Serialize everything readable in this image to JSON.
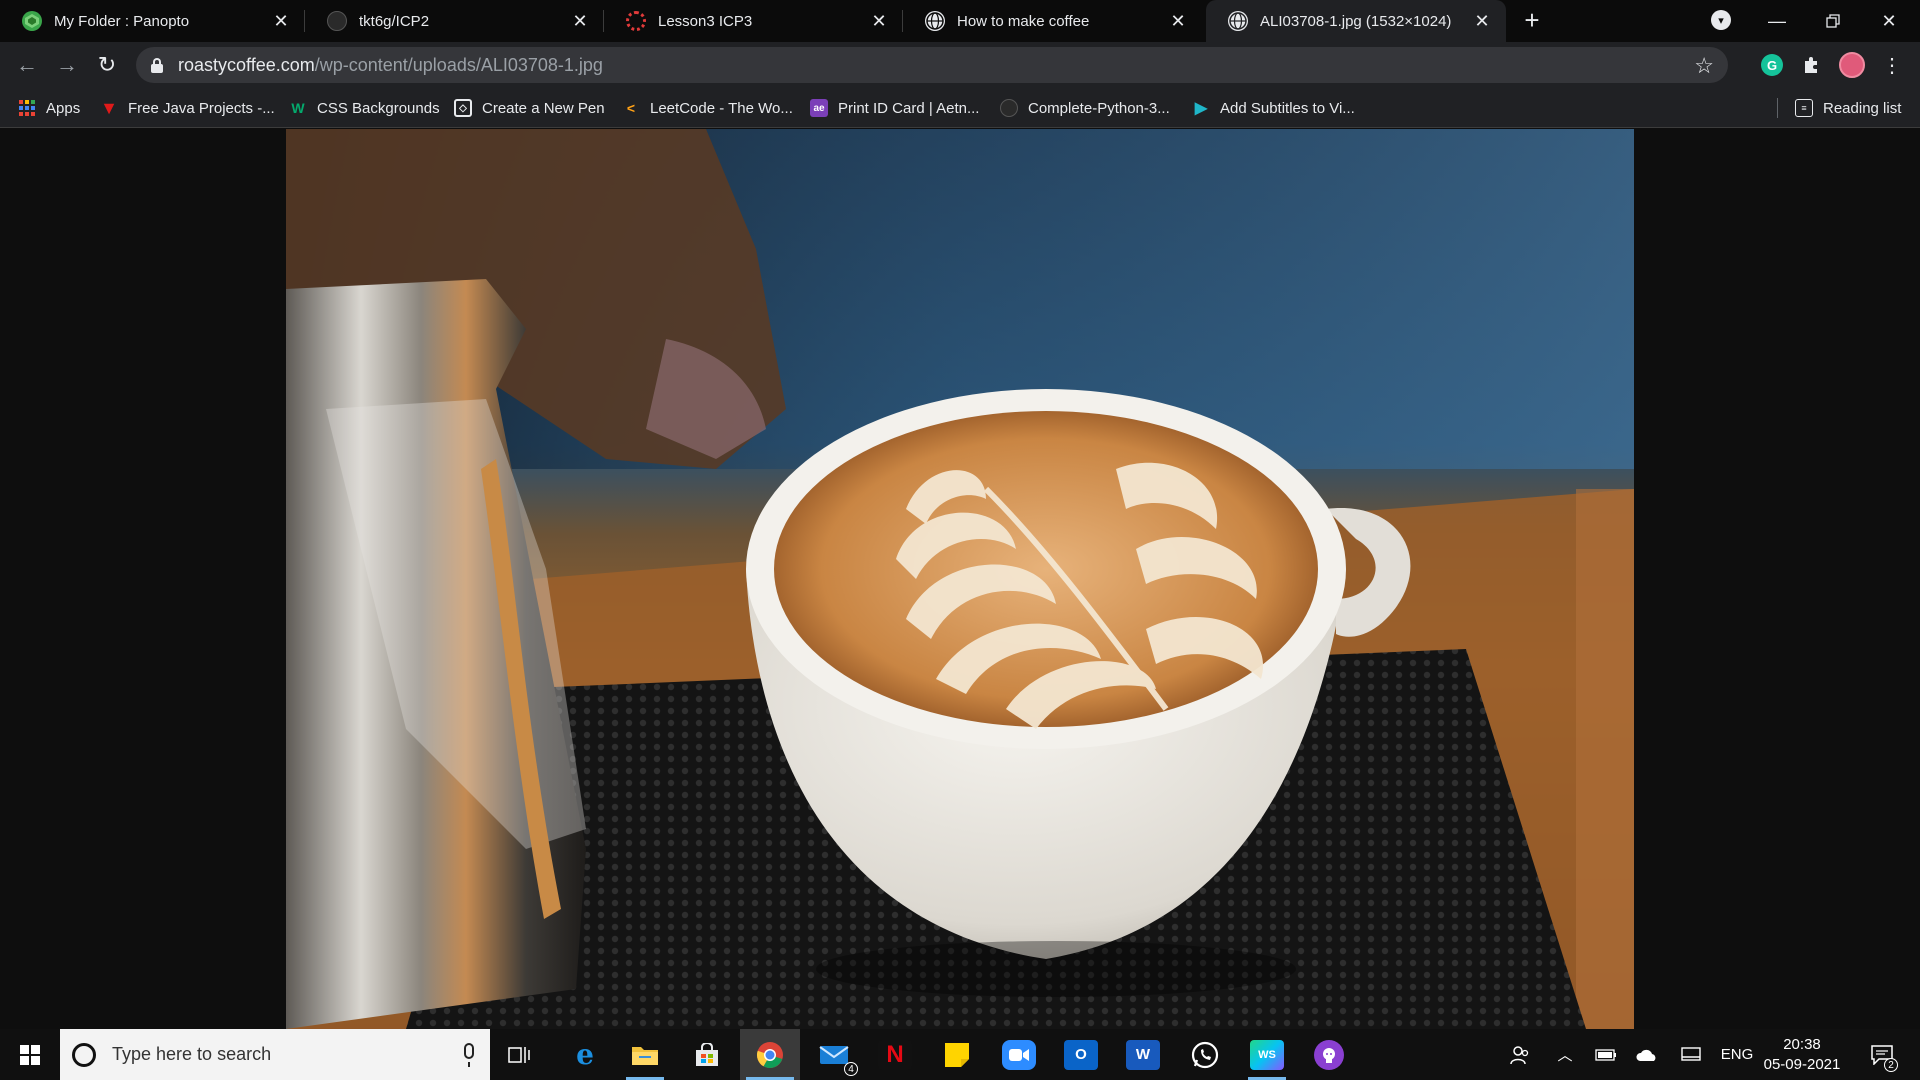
{
  "browser": {
    "tabs": [
      {
        "title": "My Folder : Panopto",
        "icon": "panopto-icon",
        "color": "#3aa64a",
        "active": false
      },
      {
        "title": "tkt6g/ICP2",
        "icon": "github-icon",
        "color": "#3c3c3c",
        "active": false
      },
      {
        "title": "Lesson3 ICP3",
        "icon": "ring-icon",
        "color": "#d03030",
        "active": false
      },
      {
        "title": "How to make coffee",
        "icon": "globe-icon",
        "color": "#e8eaed",
        "active": false
      },
      {
        "title": "ALI03708-1.jpg (1532×1024)",
        "icon": "globe-icon",
        "color": "#e8eaed",
        "active": true
      }
    ],
    "address": {
      "host": "roastycoffee.com",
      "path": "/wp-content/uploads/ALI03708-1.jpg"
    },
    "bookmarks": [
      {
        "label": "Apps",
        "icon": "apps-grid-icon"
      },
      {
        "label": "Free Java Projects -...",
        "icon": "red-v-icon"
      },
      {
        "label": "CSS Backgrounds",
        "icon": "w3-icon"
      },
      {
        "label": "Create a New Pen",
        "icon": "codepen-icon"
      },
      {
        "label": "LeetCode - The Wo...",
        "icon": "leetcode-icon"
      },
      {
        "label": "Print ID Card | Aetn...",
        "icon": "aetn-icon"
      },
      {
        "label": "Complete-Python-3...",
        "icon": "github-icon"
      },
      {
        "label": "Add Subtitles to Vi...",
        "icon": "play-icon"
      }
    ],
    "reading_list": "Reading list"
  },
  "taskbar": {
    "search_placeholder": "Type here to search",
    "mail_badge": "4",
    "language": "ENG",
    "time": "20:38",
    "date": "05-09-2021",
    "notifications_badge": "2"
  }
}
